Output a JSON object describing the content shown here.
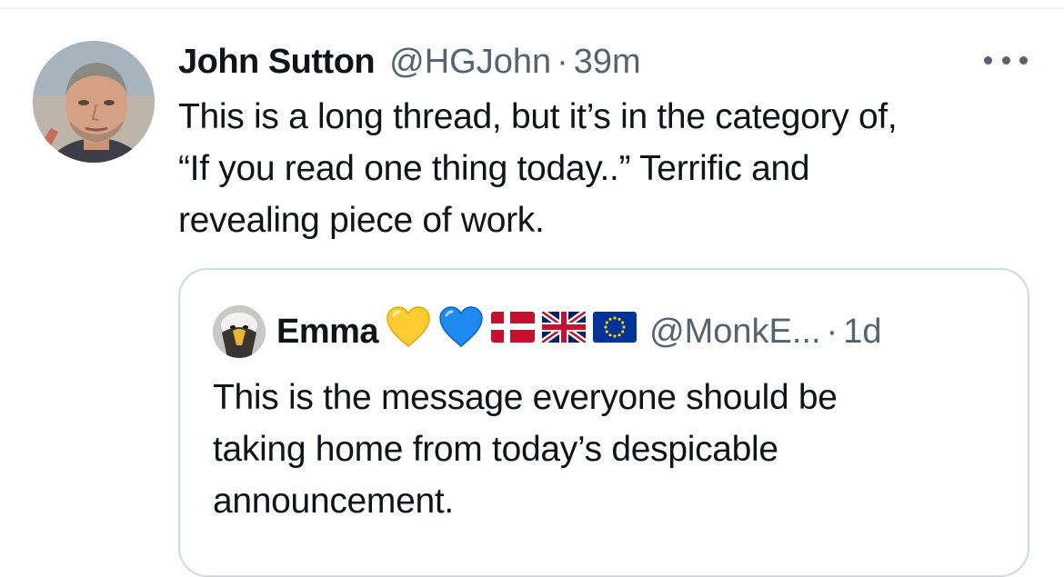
{
  "tweet": {
    "author_name": "John Sutton",
    "handle": "@HGJohn",
    "separator": "·",
    "time": "39m",
    "avatar_icon": "profile-photo-man",
    "more_icon": "more-horizontal-icon",
    "lines": [
      "This is a long thread, but it’s in the category of,",
      "“If you read one thing today..” Terrific and",
      "revealing piece of work."
    ]
  },
  "quoted_tweet": {
    "author_name": "Emma",
    "handle": "@MonkE...",
    "separator": "·",
    "time": "1d",
    "avatar_icon": "eagle-avatar",
    "name_emojis": [
      "yellow-heart",
      "blue-heart",
      "flag-denmark",
      "flag-united-kingdom",
      "flag-european-union"
    ],
    "lines": [
      "This is the message everyone should be",
      "taking home from today’s despicable",
      "announcement."
    ]
  },
  "colors": {
    "text_primary": "#0f1419",
    "text_secondary": "#536471",
    "border": "#cfd9de",
    "yellow_heart": "#ffcc32",
    "blue_heart": "#1d8bf1",
    "denmark_red": "#c8102e",
    "uk_blue": "#012169",
    "eu_blue": "#003399",
    "eu_gold": "#ffcc00"
  }
}
